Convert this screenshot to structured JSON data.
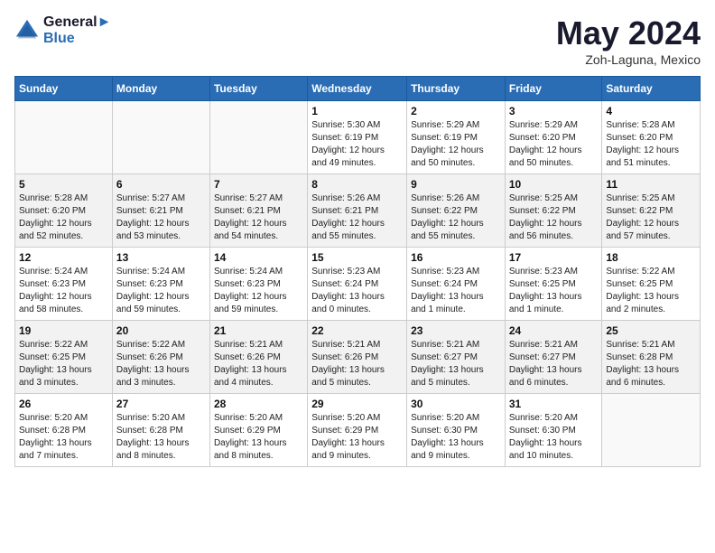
{
  "logo": {
    "line1": "General",
    "line2": "Blue"
  },
  "title": "May 2024",
  "subtitle": "Zoh-Laguna, Mexico",
  "days_header": [
    "Sunday",
    "Monday",
    "Tuesday",
    "Wednesday",
    "Thursday",
    "Friday",
    "Saturday"
  ],
  "weeks": [
    [
      {
        "num": "",
        "info": ""
      },
      {
        "num": "",
        "info": ""
      },
      {
        "num": "",
        "info": ""
      },
      {
        "num": "1",
        "info": "Sunrise: 5:30 AM\nSunset: 6:19 PM\nDaylight: 12 hours\nand 49 minutes."
      },
      {
        "num": "2",
        "info": "Sunrise: 5:29 AM\nSunset: 6:19 PM\nDaylight: 12 hours\nand 50 minutes."
      },
      {
        "num": "3",
        "info": "Sunrise: 5:29 AM\nSunset: 6:20 PM\nDaylight: 12 hours\nand 50 minutes."
      },
      {
        "num": "4",
        "info": "Sunrise: 5:28 AM\nSunset: 6:20 PM\nDaylight: 12 hours\nand 51 minutes."
      }
    ],
    [
      {
        "num": "5",
        "info": "Sunrise: 5:28 AM\nSunset: 6:20 PM\nDaylight: 12 hours\nand 52 minutes."
      },
      {
        "num": "6",
        "info": "Sunrise: 5:27 AM\nSunset: 6:21 PM\nDaylight: 12 hours\nand 53 minutes."
      },
      {
        "num": "7",
        "info": "Sunrise: 5:27 AM\nSunset: 6:21 PM\nDaylight: 12 hours\nand 54 minutes."
      },
      {
        "num": "8",
        "info": "Sunrise: 5:26 AM\nSunset: 6:21 PM\nDaylight: 12 hours\nand 55 minutes."
      },
      {
        "num": "9",
        "info": "Sunrise: 5:26 AM\nSunset: 6:22 PM\nDaylight: 12 hours\nand 55 minutes."
      },
      {
        "num": "10",
        "info": "Sunrise: 5:25 AM\nSunset: 6:22 PM\nDaylight: 12 hours\nand 56 minutes."
      },
      {
        "num": "11",
        "info": "Sunrise: 5:25 AM\nSunset: 6:22 PM\nDaylight: 12 hours\nand 57 minutes."
      }
    ],
    [
      {
        "num": "12",
        "info": "Sunrise: 5:24 AM\nSunset: 6:23 PM\nDaylight: 12 hours\nand 58 minutes."
      },
      {
        "num": "13",
        "info": "Sunrise: 5:24 AM\nSunset: 6:23 PM\nDaylight: 12 hours\nand 59 minutes."
      },
      {
        "num": "14",
        "info": "Sunrise: 5:24 AM\nSunset: 6:23 PM\nDaylight: 12 hours\nand 59 minutes."
      },
      {
        "num": "15",
        "info": "Sunrise: 5:23 AM\nSunset: 6:24 PM\nDaylight: 13 hours\nand 0 minutes."
      },
      {
        "num": "16",
        "info": "Sunrise: 5:23 AM\nSunset: 6:24 PM\nDaylight: 13 hours\nand 1 minute."
      },
      {
        "num": "17",
        "info": "Sunrise: 5:23 AM\nSunset: 6:25 PM\nDaylight: 13 hours\nand 1 minute."
      },
      {
        "num": "18",
        "info": "Sunrise: 5:22 AM\nSunset: 6:25 PM\nDaylight: 13 hours\nand 2 minutes."
      }
    ],
    [
      {
        "num": "19",
        "info": "Sunrise: 5:22 AM\nSunset: 6:25 PM\nDaylight: 13 hours\nand 3 minutes."
      },
      {
        "num": "20",
        "info": "Sunrise: 5:22 AM\nSunset: 6:26 PM\nDaylight: 13 hours\nand 3 minutes."
      },
      {
        "num": "21",
        "info": "Sunrise: 5:21 AM\nSunset: 6:26 PM\nDaylight: 13 hours\nand 4 minutes."
      },
      {
        "num": "22",
        "info": "Sunrise: 5:21 AM\nSunset: 6:26 PM\nDaylight: 13 hours\nand 5 minutes."
      },
      {
        "num": "23",
        "info": "Sunrise: 5:21 AM\nSunset: 6:27 PM\nDaylight: 13 hours\nand 5 minutes."
      },
      {
        "num": "24",
        "info": "Sunrise: 5:21 AM\nSunset: 6:27 PM\nDaylight: 13 hours\nand 6 minutes."
      },
      {
        "num": "25",
        "info": "Sunrise: 5:21 AM\nSunset: 6:28 PM\nDaylight: 13 hours\nand 6 minutes."
      }
    ],
    [
      {
        "num": "26",
        "info": "Sunrise: 5:20 AM\nSunset: 6:28 PM\nDaylight: 13 hours\nand 7 minutes."
      },
      {
        "num": "27",
        "info": "Sunrise: 5:20 AM\nSunset: 6:28 PM\nDaylight: 13 hours\nand 8 minutes."
      },
      {
        "num": "28",
        "info": "Sunrise: 5:20 AM\nSunset: 6:29 PM\nDaylight: 13 hours\nand 8 minutes."
      },
      {
        "num": "29",
        "info": "Sunrise: 5:20 AM\nSunset: 6:29 PM\nDaylight: 13 hours\nand 9 minutes."
      },
      {
        "num": "30",
        "info": "Sunrise: 5:20 AM\nSunset: 6:30 PM\nDaylight: 13 hours\nand 9 minutes."
      },
      {
        "num": "31",
        "info": "Sunrise: 5:20 AM\nSunset: 6:30 PM\nDaylight: 13 hours\nand 10 minutes."
      },
      {
        "num": "",
        "info": ""
      }
    ]
  ]
}
